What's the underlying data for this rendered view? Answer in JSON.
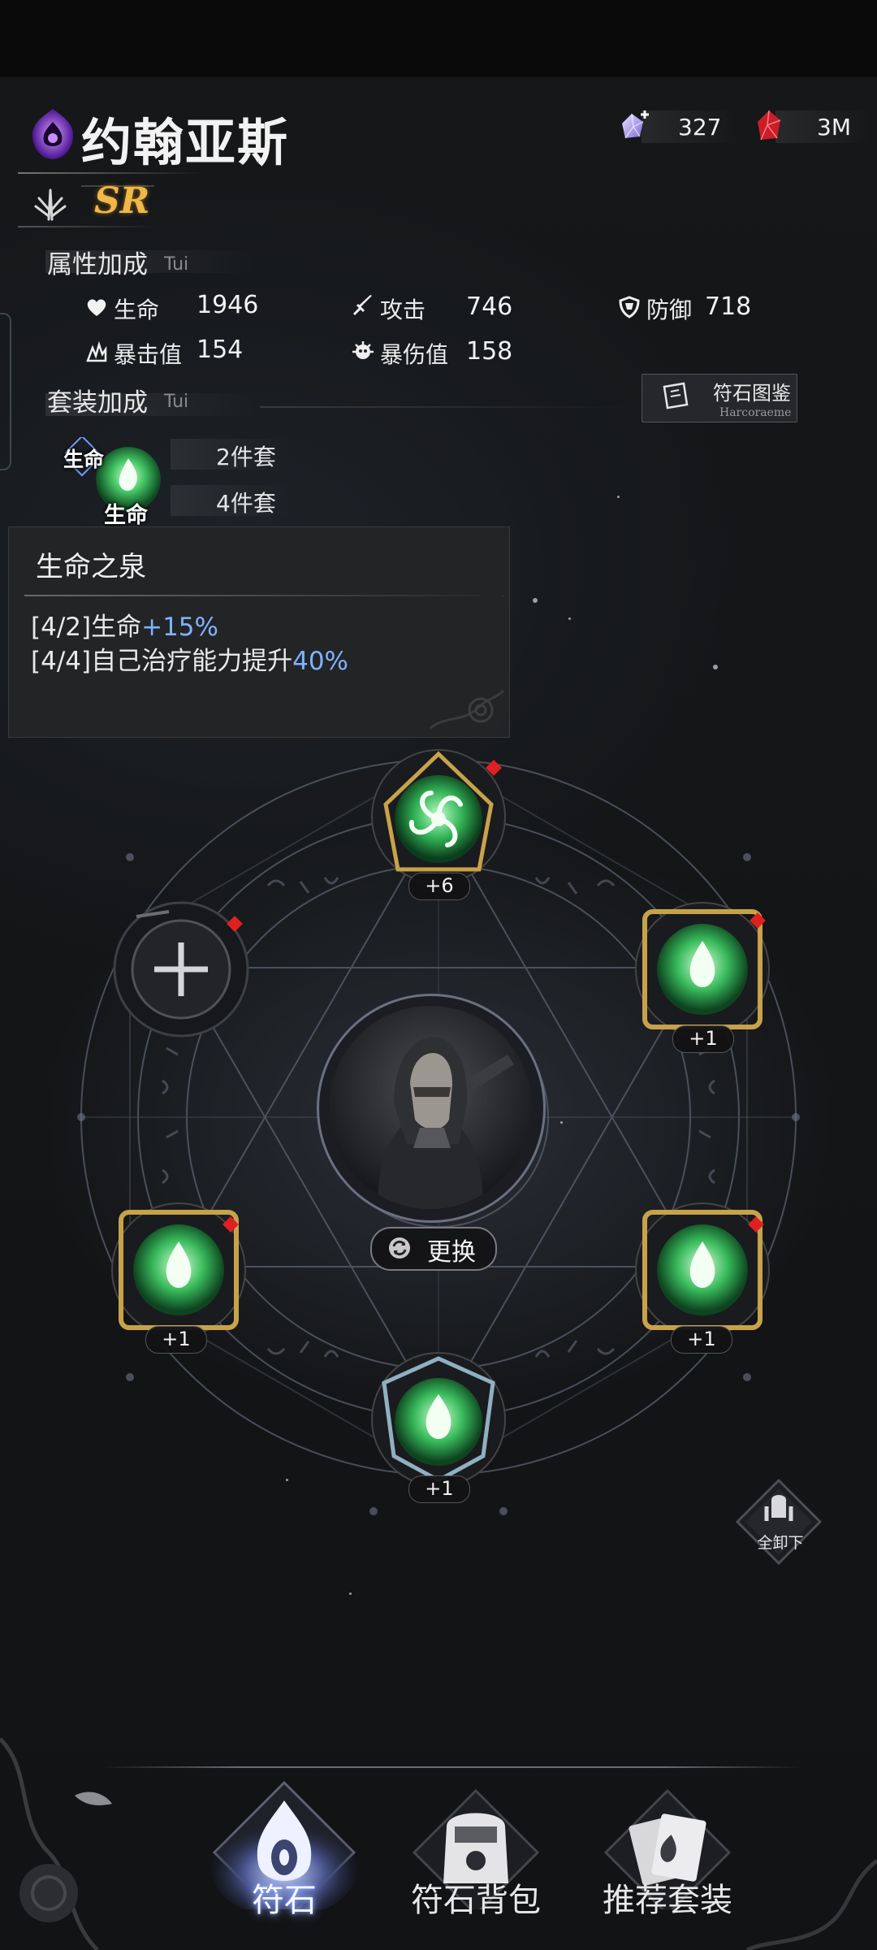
{
  "header": {
    "hero_name": "约翰亚斯",
    "rarity": "SR"
  },
  "currency": [
    {
      "icon": "crystal-plus-icon",
      "value": "327"
    },
    {
      "icon": "ruby-icon",
      "value": "3M"
    }
  ],
  "attributes": {
    "title": "属性加成",
    "subtitle": "Tui",
    "stats": [
      {
        "icon": "heart-icon",
        "label": "生命",
        "value": "1946"
      },
      {
        "icon": "sword-icon",
        "label": "攻击",
        "value": "746"
      },
      {
        "icon": "shield-icon",
        "label": "防御",
        "value": "718"
      },
      {
        "icon": "crit-icon",
        "label": "暴击值",
        "value": "154"
      },
      {
        "icon": "crit-damage-icon",
        "label": "暴伤值",
        "value": "158"
      }
    ]
  },
  "set_bonus": {
    "title": "套装加成",
    "subtitle": "Tui",
    "icon_tag_top": "生命",
    "icon_tag_bottom": "生命",
    "rows": [
      "2件套",
      "4件套"
    ]
  },
  "atlas_button": {
    "label": "符石图鉴",
    "sub": "Harcoraeme"
  },
  "tooltip": {
    "title": "生命之泉",
    "rows": [
      {
        "prefix": "[4/2]生命",
        "highlight": "+15%"
      },
      {
        "prefix": "[4/4]自己治疗能力提升",
        "highlight": "40%"
      }
    ]
  },
  "slots": [
    {
      "pos": "top",
      "level": "+6",
      "alert": true
    },
    {
      "pos": "upper-right",
      "level": "+1",
      "alert": true
    },
    {
      "pos": "lower-right",
      "level": "+1",
      "alert": true
    },
    {
      "pos": "bottom",
      "level": "+1",
      "alert": false
    },
    {
      "pos": "lower-left",
      "level": "+1",
      "alert": true
    },
    {
      "pos": "upper-left",
      "level": "",
      "alert": true
    }
  ],
  "center": {
    "change_label": "更换"
  },
  "unequip": {
    "label": "全卸下"
  },
  "nav": [
    {
      "label": "符石",
      "icon": "rune-flame-icon",
      "active": true
    },
    {
      "label": "符石背包",
      "icon": "backpack-icon",
      "active": false
    },
    {
      "label": "推荐套装",
      "icon": "cards-icon",
      "active": false
    }
  ],
  "colors": {
    "accent_blue": "#7fb2ff",
    "rarity_gold": "#f0b848",
    "rune_green": "#3fbf5a",
    "alert_red": "#e02020"
  }
}
